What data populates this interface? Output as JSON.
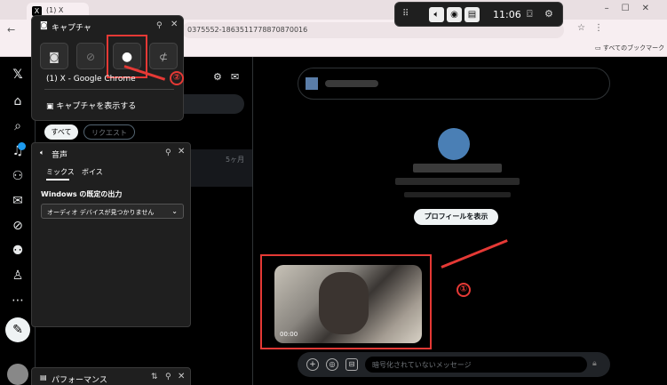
{
  "browser": {
    "tab_title": "(1) X",
    "tab_favicon": "X",
    "url_fragment": "0375552-1863511778870870016",
    "bookmarks_label": "すべてのブックマーク"
  },
  "gamebar_top": {
    "time": "11:06"
  },
  "capture_widget": {
    "title": "キャプチャ",
    "target": "(1) X - Google Chrome",
    "show_captures": "キャプチャを表示する",
    "step_marker": "②"
  },
  "audio_widget": {
    "title": "音声",
    "tabs": [
      "ミックス",
      "ボイス"
    ],
    "output_label": "Windows の既定の出力",
    "output_value": "オーディオ デバイスが見つかりません"
  },
  "performance_widget": {
    "title": "パフォーマンス"
  },
  "messages": {
    "filters": [
      "すべて",
      "リクエスト"
    ],
    "time_ago": "5ヶ月"
  },
  "conversation": {
    "view_profile": "プロフィールを表示",
    "video_timestamp": "00:00",
    "step_marker": "①",
    "composer_placeholder": "暗号化されていないメッセージ"
  },
  "colors": {
    "annotation_red": "#e53935",
    "x_blue": "#1d9bf0"
  }
}
